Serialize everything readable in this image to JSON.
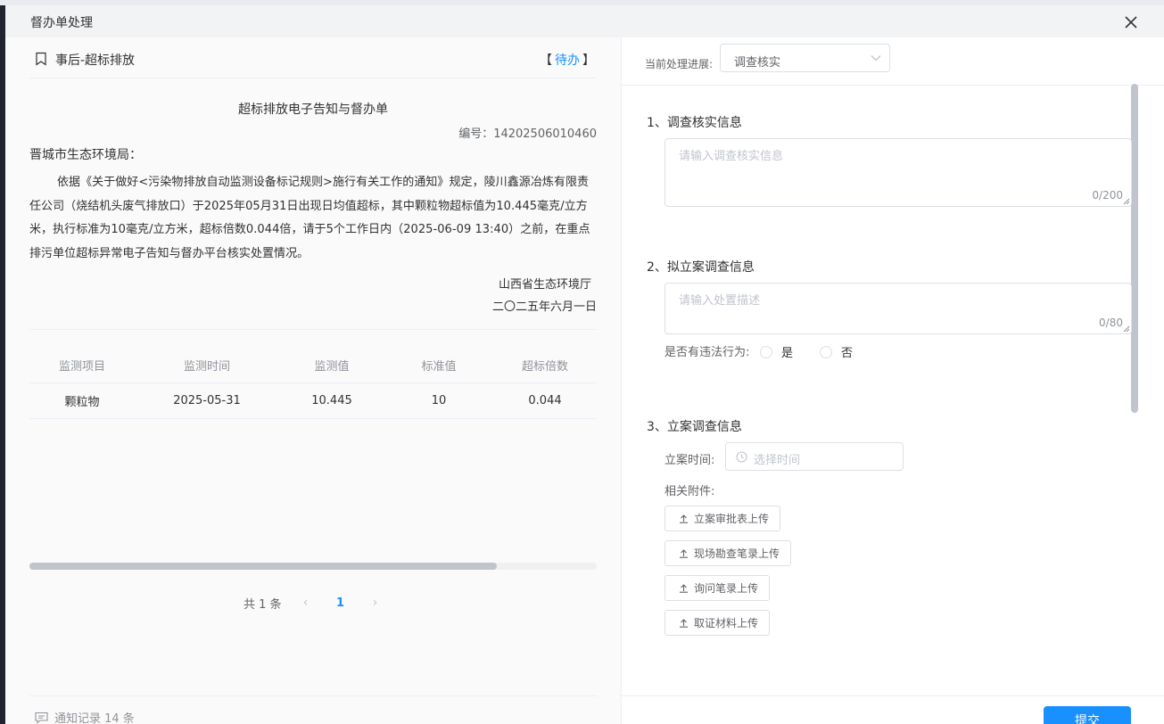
{
  "dialog": {
    "title": "督办单处理"
  },
  "left": {
    "card_title": "事后-超标排放",
    "status_open": "【",
    "status": "待办",
    "status_close": "】",
    "doc_title": "超标排放电子告知与督办单",
    "doc_number": "编号：14202506010460",
    "addressee": "晋城市生态环境局：",
    "body": "依据《关于做好<污染物排放自动监测设备标记规则>施行有关工作的通知》规定，陵川鑫源冶炼有限责任公司（烧结机头废气排放口）于2025年05月31日出现日均值超标，其中颗粒物超标值为10.445毫克/立方米，执行标准为10毫克/立方米，超标倍数0.044倍，请于5个工作日内（2025-06-09 13:40）之前，在重点排污单位超标异常电子告知与督办平台核实处置情况。",
    "signer": "山西省生态环境厅",
    "sign_date": "二〇二五年六月一日",
    "table": {
      "headers": [
        "监测项目",
        "监测时间",
        "监测值",
        "标准值",
        "超标倍数"
      ],
      "rows": [
        [
          "颗粒物",
          "2025-05-31",
          "10.445",
          "10",
          "0.044"
        ]
      ]
    },
    "pagination": {
      "total": "共 1 条",
      "prev": "‹",
      "current": "1",
      "next": "›"
    },
    "notice_log": "通知记录 14 条"
  },
  "right": {
    "progress_label": "当前处理进展:",
    "progress_value": "调查核实",
    "section1": {
      "title": "1、调查核实信息",
      "placeholder": "请输入调查核实信息",
      "count": "0/200"
    },
    "section2": {
      "title": "2、拟立案调查信息",
      "placeholder": "请输入处置描述",
      "count": "0/80",
      "violation_label": "是否有违法行为:",
      "options": [
        "是",
        "否"
      ]
    },
    "section3": {
      "title": "3、立案调查信息",
      "time_label": "立案时间:",
      "time_placeholder": "选择时间",
      "attachments_label": "相关附件:",
      "uploads": [
        "立案审批表上传",
        "现场勘查笔录上传",
        "询问笔录上传",
        "取证材料上传"
      ]
    },
    "submit": "提交"
  },
  "colors": {
    "primary": "#1890ff",
    "border": "#dcdfe6",
    "muted": "#909399"
  },
  "icons": [
    "close-icon",
    "bookmark-icon",
    "chevron-down-icon",
    "clock-icon",
    "upload-icon",
    "message-icon"
  ]
}
